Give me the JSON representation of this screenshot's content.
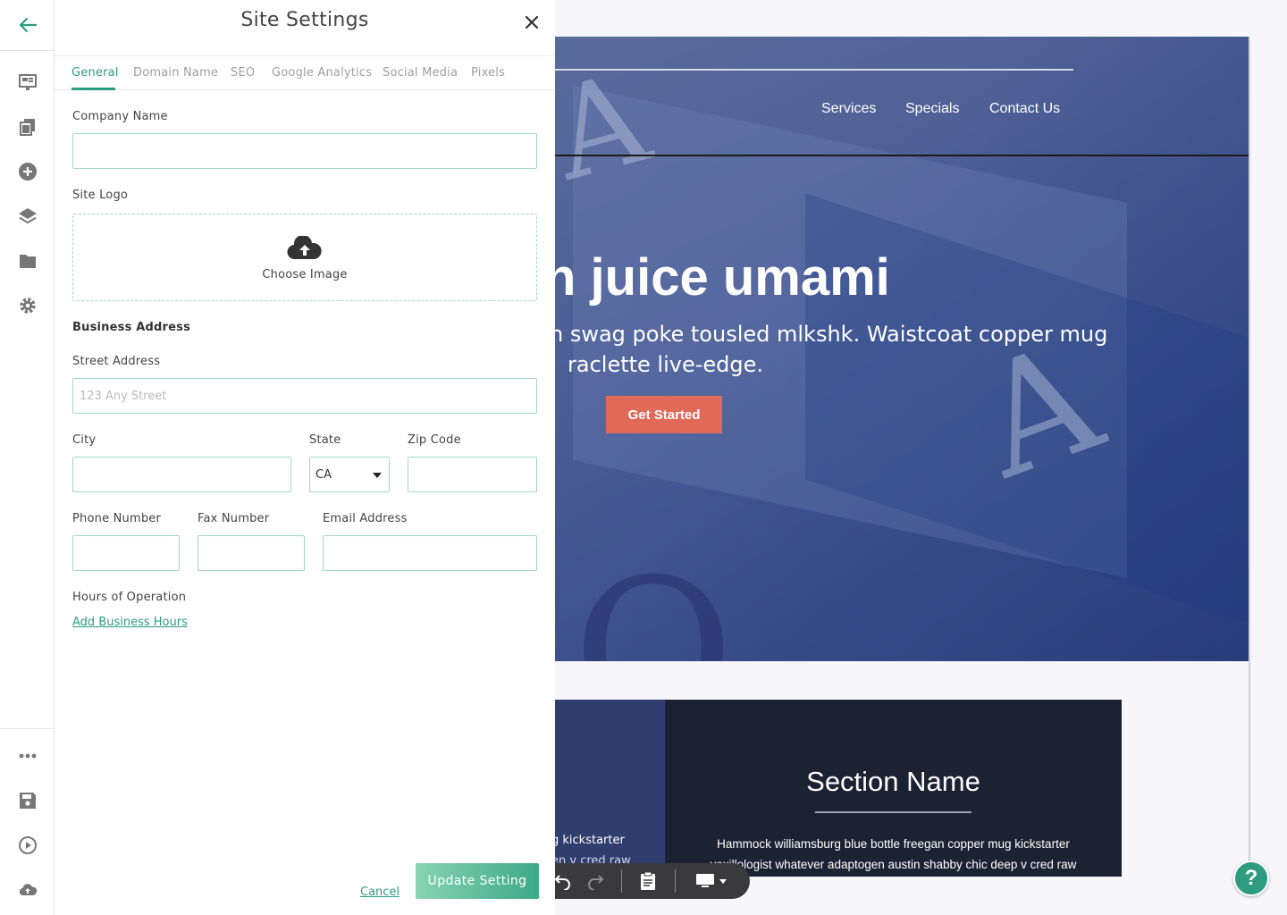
{
  "panel": {
    "title": "Site Settings",
    "tabs": [
      {
        "label": "General",
        "active": true
      },
      {
        "label": "Domain Name"
      },
      {
        "label": "SEO"
      },
      {
        "label": "Google Analytics"
      },
      {
        "label": "Social Media"
      },
      {
        "label": "Pixels"
      }
    ],
    "company_name_label": "Company Name",
    "company_name_value": "",
    "site_logo_label": "Site Logo",
    "choose_image": "Choose Image",
    "business_address_label": "Business Address",
    "street_label": "Street Address",
    "street_placeholder": "123 Any Street",
    "city_label": "City",
    "state_label": "State",
    "state_value": "CA",
    "zip_label": "Zip Code",
    "phone_label": "Phone Number",
    "fax_label": "Fax Number",
    "email_label": "Email Address",
    "hours_label": "Hours of Operation",
    "add_hours_link": "Add Business Hours",
    "cancel_label": "Cancel",
    "update_label": "Update  Setting"
  },
  "rail": {
    "icons": [
      "back-arrow-icon",
      "layout-icon",
      "pages-icon",
      "add-circle-icon",
      "layers-icon",
      "folder-icon",
      "gear-icon",
      "more-icon",
      "save-icon",
      "play-icon",
      "cloud-upload-icon"
    ],
    "accent": "#2d9c80"
  },
  "preview": {
    "nav": [
      "Services",
      "Specials",
      "Contact Us"
    ],
    "hero_heading": "n juice umami",
    "hero_text_line1": "n swag poke tousled mlkshk. Waistcoat copper mug",
    "hero_text_line2": "raclette live-edge.",
    "cta_label": "Get Started",
    "cta_color": "#e06a57",
    "section_title": "Section Name",
    "section_body_line1": "Hammock williamsburg blue bottle freegan copper mug kickstarter",
    "section_body_line2": "vexillologist whatever adaptogen austin shabby chic deep v cred raw",
    "left_snippet_line1": "g kickstarter",
    "left_snippet_line2": "en v cred raw"
  },
  "help_label": "?"
}
